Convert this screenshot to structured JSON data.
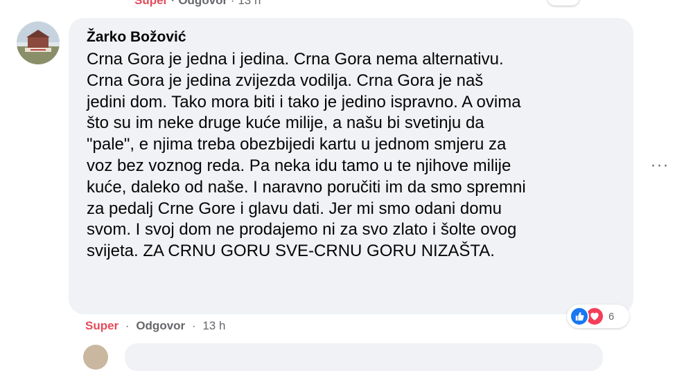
{
  "previous_comment": {
    "react_label": "Super",
    "reply_label": "Odgovor",
    "time": "13 h",
    "separator": "·"
  },
  "comment": {
    "author": "Žarko Božović",
    "lines": [
      "Crna Gora je jedna i jedina. Crna Gora nema alternativu.",
      "Crna Gora je jedina zvijezda vodilja. Crna Gora je naš",
      "jedini dom. Tako mora biti i tako je jedino ispravno. A ovima",
      "što su im neke druge kuće milije, a našu bi svetinju da",
      "\"pale\", e njima treba obezbijedi kartu u jednom smjeru za",
      "voz bez voznog reda. Pa neka idu tamo u te njihove milije",
      "kuće, daleko od naše. I naravno poručiti im da smo spremni",
      "za pedalj Crne Gore i glavu dati. Jer mi smo odani domu",
      "svom. I svoj dom ne prodajemo ni za svo zlato i šolte ovog",
      "svijeta. ZA CRNU GORU SVE-CRNU GORU NIZAŠTA."
    ],
    "reactions": {
      "icons": [
        "like-icon",
        "love-icon"
      ],
      "count": "6"
    },
    "more_options_label": "···",
    "actions": {
      "react_label": "Super",
      "reply_label": "Odgovor",
      "separator": "·",
      "time": "13 h"
    }
  },
  "colors": {
    "bubble_bg": "#f0f2f5",
    "super_red": "#e44a5a",
    "meta_gray": "#65676b",
    "like_blue": "#1877f2",
    "love_red": "#f33e58"
  }
}
